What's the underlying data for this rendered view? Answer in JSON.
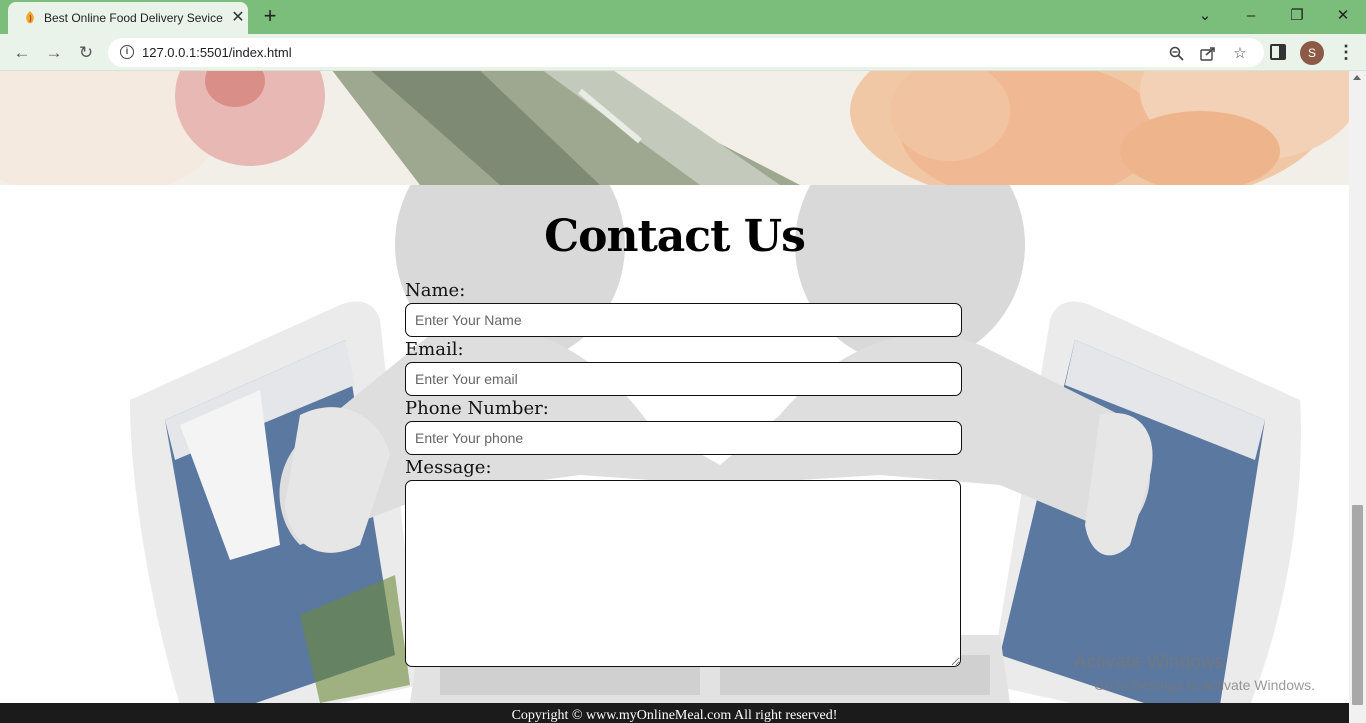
{
  "browser": {
    "tab_title": "Best Online Food Delivery Sevice",
    "url": "127.0.0.1:5501/index.html",
    "profile_initial": "S"
  },
  "page": {
    "contact": {
      "heading": "Contact Us",
      "name_label": "Name:",
      "name_placeholder": "Enter Your Name",
      "email_label": "Email:",
      "email_placeholder": "Enter Your email",
      "phone_label": "Phone Number:",
      "phone_placeholder": "Enter Your phone",
      "message_label": "Message:"
    },
    "footer": {
      "copyright": "Copyright © www.myOnlineMeal.com All right reserved!"
    }
  },
  "os_overlay": {
    "title": "Activate Windows",
    "subtitle": "Go to Settings to activate Windows."
  }
}
